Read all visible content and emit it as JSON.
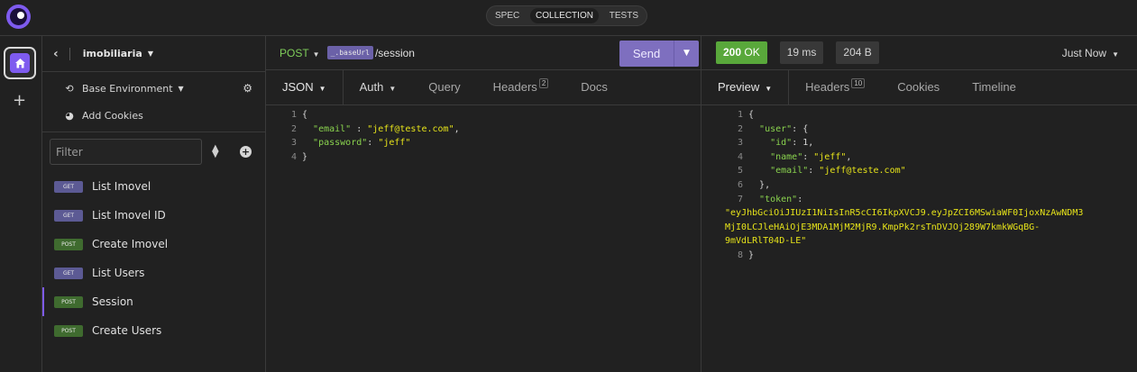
{
  "app": {
    "accent": "#7e5bef"
  },
  "topbar": {
    "tabs": [
      "SPEC",
      "COLLECTION",
      "TESTS"
    ],
    "active_tab": "COLLECTION"
  },
  "rail": {
    "home_icon": "home-icon",
    "add_icon": "plus-icon"
  },
  "sidebar": {
    "project": "imobiliaria",
    "environment": "Base Environment",
    "add_cookies": "Add Cookies",
    "filter_placeholder": "Filter",
    "requests": [
      {
        "method": "GET",
        "name": "List Imovel"
      },
      {
        "method": "GET",
        "name": "List Imovel ID"
      },
      {
        "method": "POST",
        "name": "Create Imovel"
      },
      {
        "method": "GET",
        "name": "List Users"
      },
      {
        "method": "POST",
        "name": "Session",
        "active": true
      },
      {
        "method": "POST",
        "name": "Create Users"
      }
    ]
  },
  "request": {
    "method": "POST",
    "url_var": "_.baseUrl",
    "url_path": "/session",
    "send_label": "Send",
    "tabs": {
      "body": "JSON",
      "auth": "Auth",
      "query": "Query",
      "headers": "Headers",
      "headers_count": "2",
      "docs": "Docs"
    },
    "body_lines": [
      "1",
      "2",
      "3",
      "4"
    ],
    "body": {
      "open": "{",
      "email_key": "\"email\"",
      "email_val": "\"jeff@teste.com\"",
      "password_key": "\"password\"",
      "password_val": "\"jeff\"",
      "close": "}"
    }
  },
  "response": {
    "status_code": "200",
    "status_text": "OK",
    "time": "19 ms",
    "size": "204 B",
    "when": "Just Now",
    "tabs": {
      "preview": "Preview",
      "headers": "Headers",
      "headers_count": "10",
      "cookies": "Cookies",
      "timeline": "Timeline"
    },
    "line_numbers": [
      "1",
      "2",
      "3",
      "4",
      "5",
      "6",
      "7",
      "8"
    ],
    "body": {
      "user_key": "\"user\"",
      "id_key": "\"id\"",
      "id_val": "1",
      "name_key": "\"name\"",
      "name_val": "\"jeff\"",
      "email_key": "\"email\"",
      "email_val": "\"jeff@teste.com\"",
      "token_key": "\"token\"",
      "token_line1": "\"eyJhbGciOiJIUzI1NiIsInR5cCI6IkpXVCJ9.eyJpZCI6MSwiaWF0IjoxNzAwNDM3",
      "token_line2": "MjI0LCJleHAiOjE3MDA1MjM2MjR9.KmpPk2rsTnDVJOj289W7kmkWGqBG-",
      "token_line3": "9mVdLRlT04D-LE\""
    }
  }
}
